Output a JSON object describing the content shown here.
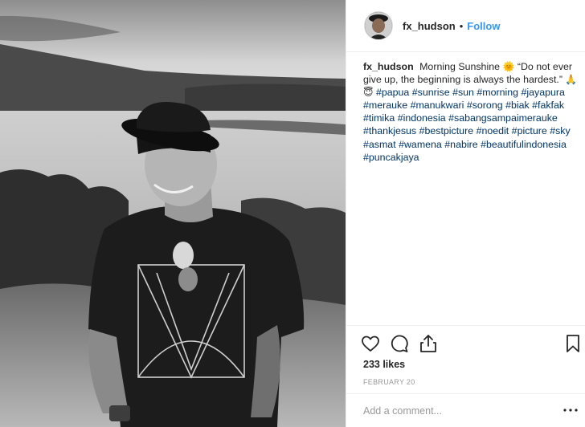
{
  "post": {
    "image_description": "photo-black-and-white-man-hat",
    "header": {
      "username": "fx_hudson",
      "separator": "•",
      "follow_label": "Follow"
    },
    "caption": {
      "username": "fx_hudson",
      "text_before_emoji": "Morning Sunshine",
      "text_after_emoji": "“Do not ever give up, the beginning is always the hardest.”",
      "emoji_sun": "🌞",
      "emoji_pray": "🙏",
      "emoji_smile": "😇",
      "hashtags": [
        "#papua",
        "#sunrise",
        "#sun",
        "#morning",
        "#jayapura",
        "#merauke",
        "#manukwari",
        "#sorong",
        "#biak",
        "#fakfak",
        "#timika",
        "#indonesia",
        "#sabangsampaimerauke",
        "#thankjesus",
        "#bestpicture",
        "#noedit",
        "#picture",
        "#sky",
        "#asmat",
        "#wamena",
        "#nabire",
        "#beautifulindonesia",
        "#puncakjaya"
      ]
    },
    "actions": {
      "like_icon": "heart-icon",
      "comment_icon": "comment-icon",
      "share_icon": "share-icon",
      "save_icon": "bookmark-icon"
    },
    "likes": "233 likes",
    "date": "FEBRUARY 20",
    "comment": {
      "placeholder": "Add a comment...",
      "more_icon": "more-options-icon"
    },
    "colors": {
      "follow": "#3897f0",
      "hashtag": "#003569",
      "muted": "#999999",
      "border": "#efefef"
    }
  }
}
